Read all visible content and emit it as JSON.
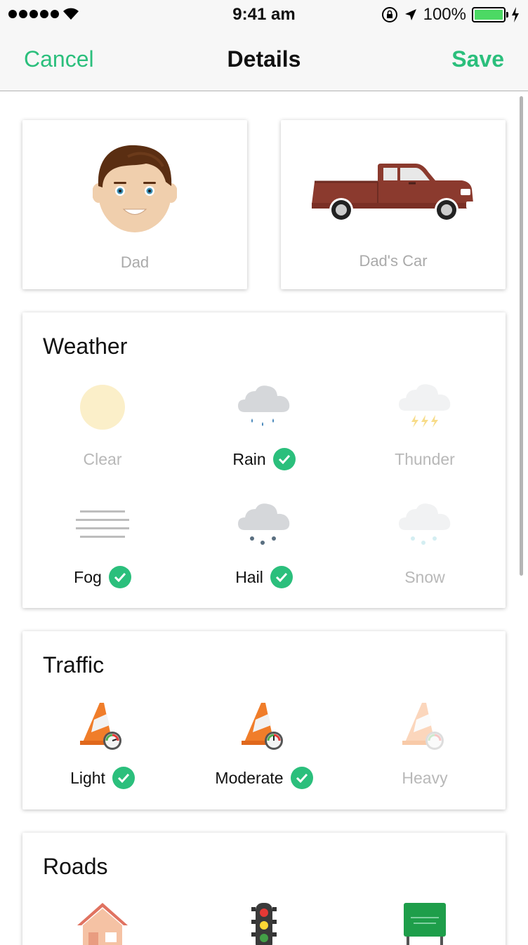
{
  "status_bar": {
    "time": "9:41 am",
    "battery": "100%"
  },
  "nav": {
    "cancel_label": "Cancel",
    "title": "Details",
    "save_label": "Save"
  },
  "profiles": [
    {
      "label": "Dad",
      "icon": "man-face-icon"
    },
    {
      "label": "Dad's Car",
      "icon": "pickup-truck-icon"
    }
  ],
  "weather": {
    "title": "Weather",
    "options": [
      {
        "label": "Clear",
        "icon": "sun-icon",
        "selected": false
      },
      {
        "label": "Rain",
        "icon": "rain-cloud-icon",
        "selected": true
      },
      {
        "label": "Thunder",
        "icon": "thunder-cloud-icon",
        "selected": false
      },
      {
        "label": "Fog",
        "icon": "fog-icon",
        "selected": true
      },
      {
        "label": "Hail",
        "icon": "hail-cloud-icon",
        "selected": true
      },
      {
        "label": "Snow",
        "icon": "snow-cloud-icon",
        "selected": false
      }
    ]
  },
  "traffic": {
    "title": "Traffic",
    "options": [
      {
        "label": "Light",
        "icon": "traffic-cone-light-icon",
        "selected": true
      },
      {
        "label": "Moderate",
        "icon": "traffic-cone-moderate-icon",
        "selected": true
      },
      {
        "label": "Heavy",
        "icon": "traffic-cone-heavy-icon",
        "selected": false
      }
    ]
  },
  "roads": {
    "title": "Roads",
    "options": [
      {
        "label": "",
        "icon": "house-icon"
      },
      {
        "label": "",
        "icon": "traffic-light-icon"
      },
      {
        "label": "",
        "icon": "highway-sign-icon"
      }
    ]
  },
  "colors": {
    "accent": "#2bbf7c",
    "unselected_text": "#b8b8b8",
    "truck": "#8b3a2e",
    "hair": "#5a2e12"
  }
}
